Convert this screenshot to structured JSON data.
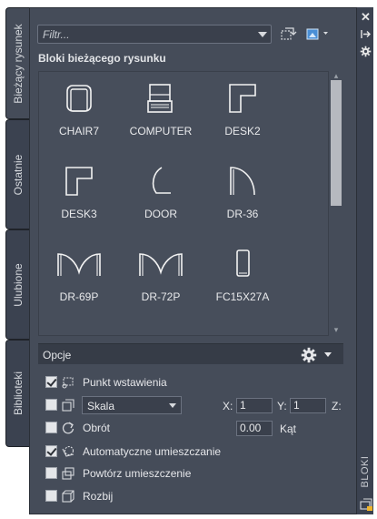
{
  "side_tabs": [
    {
      "label": "Bieżący rysunek",
      "active": true
    },
    {
      "label": "Ostatnie",
      "active": false
    },
    {
      "label": "Ulubione",
      "active": false
    },
    {
      "label": "Biblioteki",
      "active": false
    }
  ],
  "filter": {
    "placeholder": "Filtr..."
  },
  "section_title": "Bloki bieżącego rysunku",
  "blocks": [
    {
      "name": "CHAIR7",
      "icon": "chair-icon"
    },
    {
      "name": "COMPUTER",
      "icon": "computer-icon"
    },
    {
      "name": "DESK2",
      "icon": "desk-icon"
    },
    {
      "name": "DESK3",
      "icon": "desk-icon"
    },
    {
      "name": "DOOR",
      "icon": "door-icon"
    },
    {
      "name": "DR-36",
      "icon": "door-swing-icon"
    },
    {
      "name": "DR-69P",
      "icon": "double-door-icon"
    },
    {
      "name": "DR-72P",
      "icon": "double-door-icon"
    },
    {
      "name": "FC15X27A",
      "icon": "rectangle-icon"
    }
  ],
  "options": {
    "title": "Opcje",
    "insertion_point": {
      "label": "Punkt wstawienia",
      "checked": true
    },
    "scale": {
      "checked": false,
      "value": "Skala",
      "x_label": "X:",
      "x": "1",
      "y_label": "Y:",
      "y": "1",
      "z_label": "Z:"
    },
    "rotation": {
      "label": "Obrót",
      "checked": false,
      "angle": "0.00",
      "angle_label": "Kąt"
    },
    "auto_placement": {
      "label": "Automatyczne umieszczanie",
      "checked": true
    },
    "repeat_placement": {
      "label": "Powtórz umieszczenie",
      "checked": false
    },
    "explode": {
      "label": "Rozbij",
      "checked": false
    }
  },
  "palette_label": "BLOKI",
  "colors": {
    "panel": "#454c59",
    "tab": "#3b4250",
    "accent": "#e6e7ea"
  }
}
